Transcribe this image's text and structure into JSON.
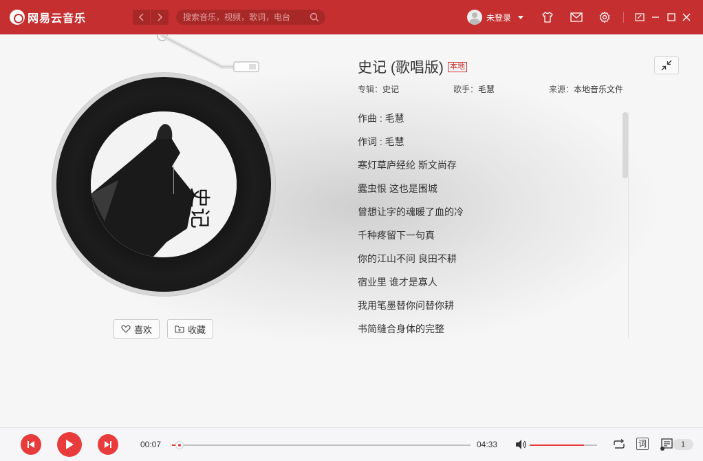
{
  "app": {
    "name": "网易云音乐"
  },
  "header": {
    "search_placeholder": "搜索音乐，视频，歌词，电台",
    "user_label": "未登录"
  },
  "song": {
    "title": "史记 (歌唱版)",
    "badge": "本地",
    "album_label": "专辑：",
    "album": "史记",
    "artist_label": "歌手：",
    "artist": "毛慧",
    "source_label": "来源：",
    "source": "本地音乐文件",
    "cover_text": "史记"
  },
  "actions": {
    "like_label": "喜欢",
    "collect_label": "收藏"
  },
  "lyrics": [
    "作曲 : 毛慧",
    "作词 : 毛慧",
    "寒灯草庐经纶 斯文尚存",
    "蠹虫恨 这也是围城",
    "曾想让字的魂暖了血的冷",
    "千种疼留下一句真",
    "你的江山不问 良田不耕",
    "宿业里 谁才是寡人",
    "我用笔墨替你问替你耕",
    "书简缝合身体的完整"
  ],
  "player": {
    "current_time": "00:07",
    "total_time": "04:33",
    "progress_fraction": 0.026,
    "volume_fraction": 0.81,
    "lyric_toggle_label": "词",
    "playlist_count": "1"
  },
  "colors": {
    "brand_red": "#c62f2f",
    "accent_red": "#e83c3c"
  }
}
